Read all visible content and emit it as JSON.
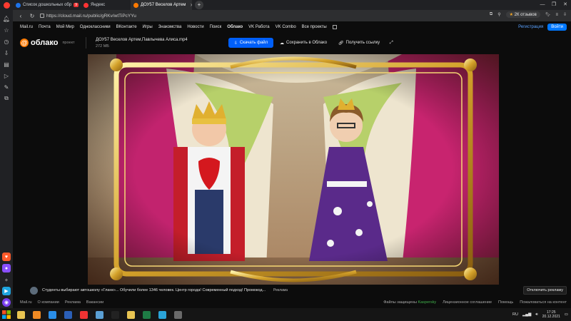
{
  "browser": {
    "tabs": [
      {
        "label": "Список дошкольных обр",
        "color": "#1e73e8",
        "active": false
      },
      {
        "label": "Яндекс",
        "color": "#f33",
        "active": false
      },
      {
        "label": "ДОУ57 Веселов Артем",
        "color": "#ff7a00",
        "active": true
      }
    ],
    "badge": "9",
    "new_tab": "+",
    "url": "https://cloud.mail.ru/public/gRKv/wtTiPcYYu",
    "rating_star": "★",
    "rating_label": "2К отзывов",
    "window_controls": [
      "—",
      "❐",
      "✕"
    ]
  },
  "mailru_nav": {
    "items": [
      "Mail.ru",
      "Почта",
      "Мой Мир",
      "Одноклассники",
      "ВКонтакте",
      "Игры",
      "Знакомства",
      "Новости",
      "Поиск",
      "Облако",
      "VK Работа",
      "VK Combo",
      "Все проекты"
    ],
    "register": "Регистрация",
    "login": "Войти"
  },
  "cloud": {
    "logo_text": "облако",
    "logo_suffix": "проект",
    "file_name": "ДОУ57 Веселов Артем,Павлычева Алиса.mp4",
    "file_size": "272 МБ",
    "download_label": "Скачать файл",
    "save_label": "Сохранить в Облако",
    "link_label": "Получить ссылку"
  },
  "ad": {
    "text": "Студенты выбирают автошколу «Гланк»... Обучили более 1346 человек. Центр города! Современный подход! Промокод...",
    "label": "Реклама",
    "disable": "Отключить рекламу"
  },
  "footer": {
    "left": [
      "Mail.ru",
      "О компании",
      "Реклама",
      "Вакансии"
    ],
    "protected_prefix": "Файлы защищены",
    "protected_brand": "Kaspersky",
    "right": [
      "Лицензионное соглашение",
      "Помощь",
      "Пожаловаться на контент"
    ]
  },
  "taskbar": {
    "lang": "RU",
    "time": "17:25",
    "date": "20.12.2021",
    "icons": [
      {
        "name": "explorer-icon",
        "color": "#e8c452"
      },
      {
        "name": "media-player-icon",
        "color": "#f08a24"
      },
      {
        "name": "ie-icon",
        "color": "#2a8ee8"
      },
      {
        "name": "word-icon",
        "color": "#2b5fb7"
      },
      {
        "name": "yandex-icon",
        "color": "#e33"
      },
      {
        "name": "photo-icon",
        "color": "#5a9fd4"
      },
      {
        "name": "batman-icon",
        "color": "#222"
      },
      {
        "name": "folder-icon",
        "color": "#e8c452"
      },
      {
        "name": "excel-icon",
        "color": "#1e7b45"
      },
      {
        "name": "paint-icon",
        "color": "#2aa3d8"
      },
      {
        "name": "calc-icon",
        "color": "#6a6a6a"
      }
    ]
  }
}
